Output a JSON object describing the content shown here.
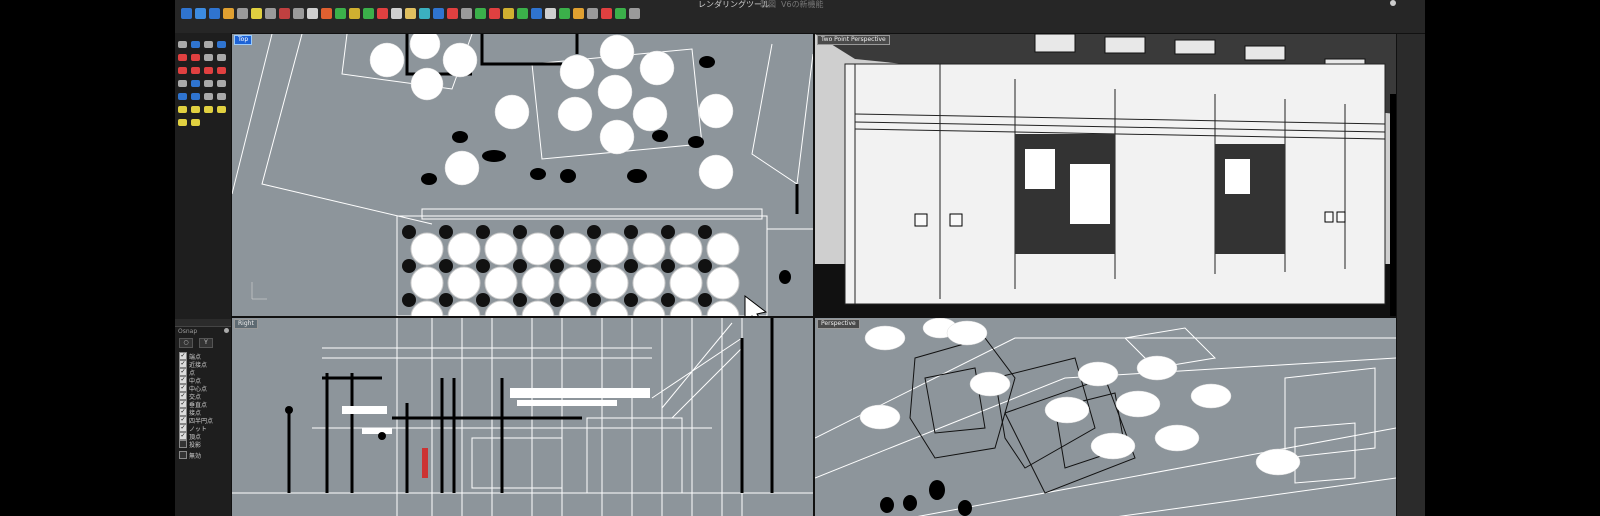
{
  "toolbar": {
    "tab_rendering": "レンダリングツール",
    "tab_faded_1": "製図",
    "tab_faded_2": "V6の新機能",
    "icon_colors": [
      "#2f74d0",
      "#3c8be0",
      "#2f74d0",
      "#e0a030",
      "#9a9a9a",
      "#e0d040",
      "#9a9a9a",
      "#c04040",
      "#9a9a9a",
      "#d0d0d0",
      "#e06030",
      "#3bb04a",
      "#d0b030",
      "#3bb04a",
      "#e04040",
      "#d0d0d0",
      "#e0c060",
      "#3bb0c0",
      "#2f74d0",
      "#e04040",
      "#9a9a9a",
      "#3bb04a",
      "#e04040",
      "#d0b030",
      "#3bb04a",
      "#2f74d0",
      "#d0d0d0",
      "#3bb04a",
      "#e0a030",
      "#9a9a9a",
      "#e04040",
      "#3bb04a",
      "#9a9a9a"
    ]
  },
  "viewports": {
    "top": {
      "label": "Top"
    },
    "two_point": {
      "label": "Two Point Perspective"
    },
    "right": {
      "label": "Right"
    },
    "perspective": {
      "label": "Perspective"
    }
  },
  "osnap": {
    "title": "Osnap",
    "items": [
      {
        "label": "端点",
        "checked": true
      },
      {
        "label": "近接点",
        "checked": true
      },
      {
        "label": "点",
        "checked": true
      },
      {
        "label": "中点",
        "checked": true
      },
      {
        "label": "中心点",
        "checked": true
      },
      {
        "label": "交点",
        "checked": true
      },
      {
        "label": "垂直点",
        "checked": true
      },
      {
        "label": "接点",
        "checked": true
      },
      {
        "label": "四半円点",
        "checked": true
      },
      {
        "label": "ノット",
        "checked": true
      },
      {
        "label": "頂点",
        "checked": true
      },
      {
        "label": "投影",
        "checked": false
      }
    ],
    "disable_label": "無効"
  },
  "colors": {
    "viewport_bg": "#8d959b",
    "active_label": "#1e63d6",
    "panel_bg": "#1e1e1e",
    "toolbar_bg": "#262626"
  }
}
